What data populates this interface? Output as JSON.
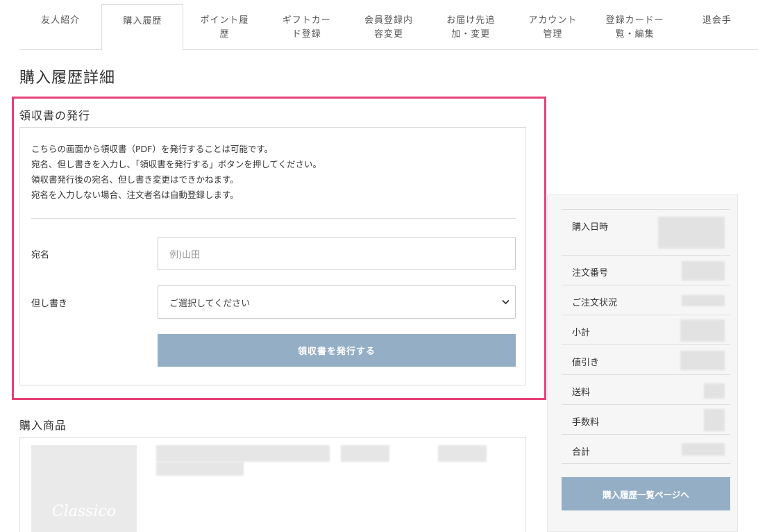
{
  "tabs": [
    {
      "label": "友人紹介"
    },
    {
      "label": "購入履歴"
    },
    {
      "label": "ポイント履\n歴"
    },
    {
      "label": "ギフトカー\nド登録"
    },
    {
      "label": "会員登録内\n容変更"
    },
    {
      "label": "お届け先追\n加・変更"
    },
    {
      "label": "アカウント\n管理"
    },
    {
      "label": "登録カードー\n覧・編集"
    },
    {
      "label": "退会手"
    }
  ],
  "page_title": "購入履歴詳細",
  "receipt": {
    "title": "領収書の発行",
    "description": [
      "こちらの画面から領収書（PDF）を発行することは可能です。",
      "宛名、但し書きを入力し、「領収書を発行する」ボタンを押してください。",
      "領収書発行後の宛名、但し書き変更はできかねます。",
      "宛名を入力しない場合、注文者名は自動登録します。"
    ],
    "name_label": "宛名",
    "name_placeholder": "例)山田",
    "proviso_label": "但し書き",
    "proviso_selected": "ご選択してください",
    "issue_button": "領収書を発行する"
  },
  "products": {
    "title": "購入商品",
    "image_text": "Classico"
  },
  "summary": {
    "rows": [
      {
        "label": "購入日時"
      },
      {
        "label": "注文番号"
      },
      {
        "label": "ご注文状況"
      },
      {
        "label": "小計"
      },
      {
        "label": "値引き"
      },
      {
        "label": "送料"
      },
      {
        "label": "手数料"
      },
      {
        "label": "合計"
      }
    ],
    "back_button": "購入履歴一覧ページへ"
  },
  "colors": {
    "highlight": "#e6407a",
    "button": "#94aec6"
  }
}
